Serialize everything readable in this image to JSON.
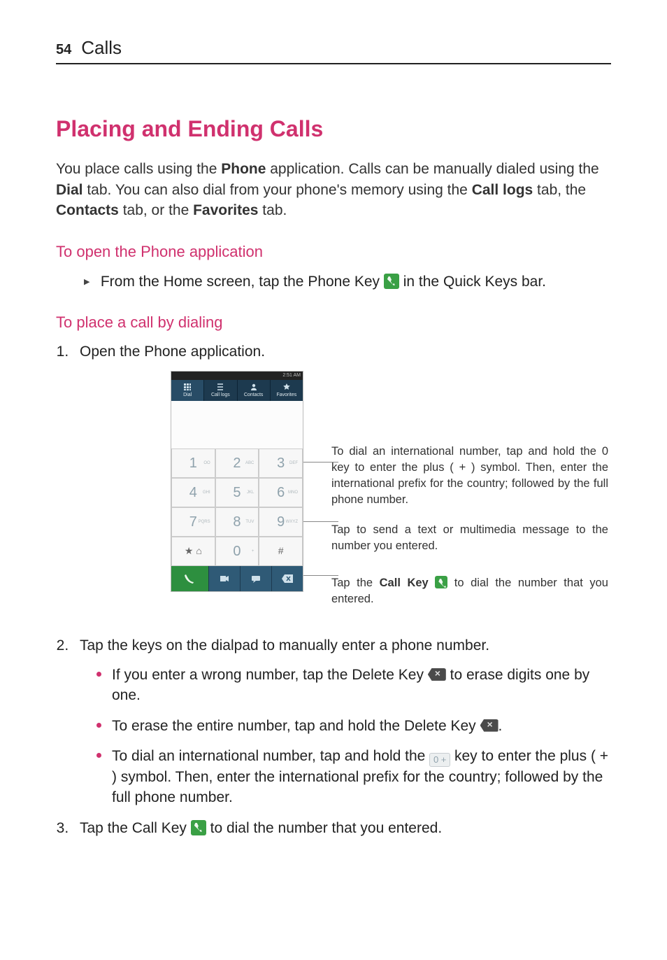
{
  "header": {
    "page_number": "54",
    "section": "Calls"
  },
  "title": "Placing and Ending Calls",
  "intro": {
    "p1_a": "You place calls using the ",
    "p1_b": "Phone",
    "p1_c": " application. Calls can be manually dialed using the ",
    "p1_d": "Dial",
    "p1_e": " tab. You can also dial from your phone's memory using the ",
    "p1_f": "Call logs",
    "p1_g": " tab, the ",
    "p1_h": "Contacts",
    "p1_i": " tab, or the ",
    "p1_j": "Favorites",
    "p1_k": " tab."
  },
  "sub1": {
    "heading": "To open the Phone application",
    "step_a": "From the Home screen, tap the ",
    "step_b": "Phone Key",
    "step_c": " in the Quick Keys bar."
  },
  "sub2": {
    "heading": "To place a call by dialing",
    "step1_a": "Open the ",
    "step1_b": "Phone",
    "step1_c": " application.",
    "callout1": "To dial an international number, tap and hold the 0 key to enter the plus ( + ) symbol. Then, enter the international prefix for the country; followed by the full phone number.",
    "callout2": "Tap to send a text or multimedia message to the number you entered.",
    "callout3_a": "Tap the ",
    "callout3_b": "Call Key",
    "callout3_c": " to dial the number that you entered.",
    "step2": "Tap the keys on the dialpad to manually enter a phone number.",
    "bullet1_a": "If you enter a wrong number, tap the ",
    "bullet1_b": "Delete Key",
    "bullet1_c": " to erase digits one by one.",
    "bullet2_a": "To erase the entire number, tap and hold the ",
    "bullet2_b": "Delete Key",
    "bullet2_c": ".",
    "bullet3_a": "To dial an international number, tap and hold the ",
    "bullet3_c": " key to enter the plus ( ",
    "bullet3_d": "+",
    "bullet3_e": " ) symbol. Then, enter the international prefix for the country; followed by the full phone number.",
    "step3_a": "Tap the ",
    "step3_b": "Call Key",
    "step3_c": " to dial the number that you entered."
  },
  "phone_ui": {
    "status_time": "2:51 AM",
    "tabs": [
      "Dial",
      "Call logs",
      "Contacts",
      "Favorites"
    ],
    "keys": [
      {
        "n": "1",
        "sub": "OO"
      },
      {
        "n": "2",
        "sub": "ABC"
      },
      {
        "n": "3",
        "sub": "DEF"
      },
      {
        "n": "4",
        "sub": "GHI"
      },
      {
        "n": "5",
        "sub": "JKL"
      },
      {
        "n": "6",
        "sub": "MNO"
      },
      {
        "n": "7",
        "sub": "PQRS"
      },
      {
        "n": "8",
        "sub": "TUV"
      },
      {
        "n": "9",
        "sub": "WXYZ"
      },
      {
        "n": "★ ⌂",
        "sub": ""
      },
      {
        "n": "0",
        "sub": "+"
      },
      {
        "n": "#",
        "sub": ""
      }
    ],
    "zero_key_label": "0 +"
  }
}
